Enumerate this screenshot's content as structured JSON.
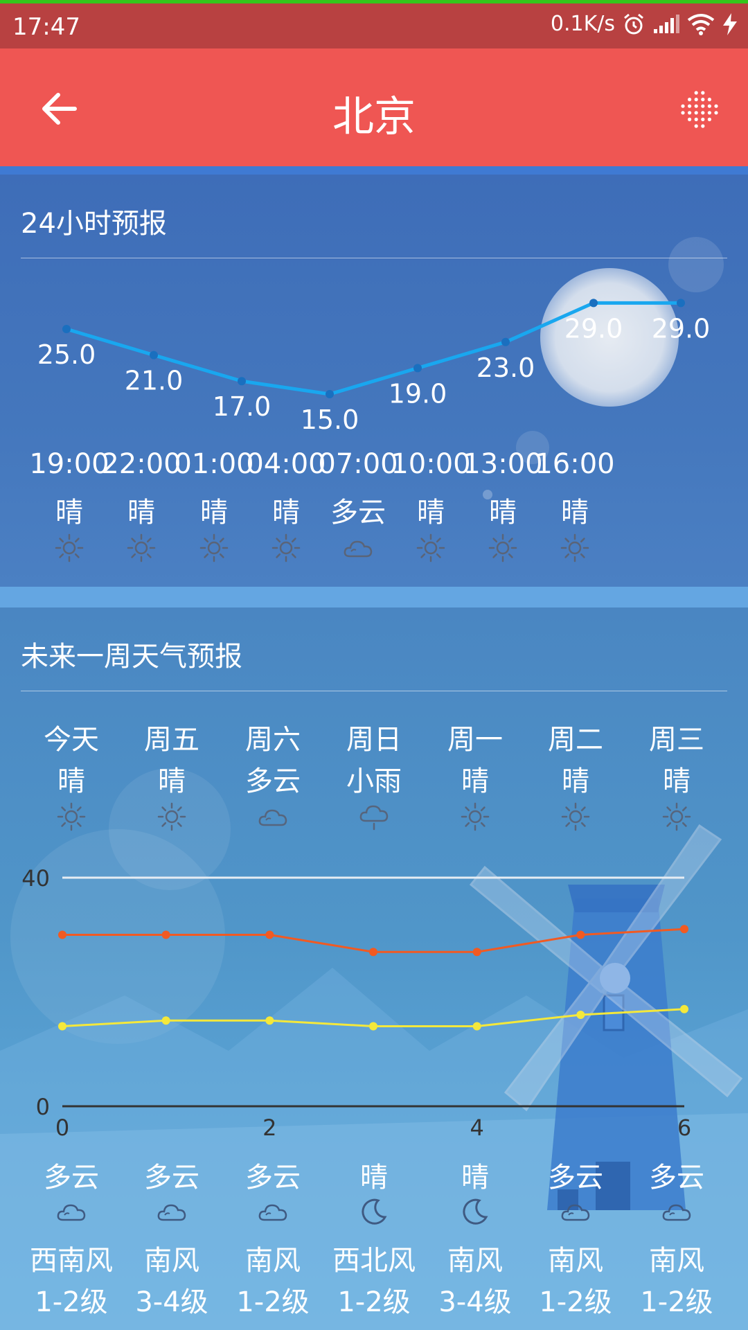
{
  "status_bar": {
    "time": "17:47",
    "net_speed": "0.1K/s",
    "icons": [
      "alarm-icon",
      "signal-icon",
      "wifi-icon",
      "charging-icon"
    ]
  },
  "app_bar": {
    "title": "北京",
    "back_icon": "arrow-left-icon",
    "menu_icon": "dots-grid-icon"
  },
  "hourly": {
    "title": "24小时预报",
    "items": [
      {
        "time": "19:00",
        "temp": "25.0",
        "desc": "晴",
        "icon": "sun-icon"
      },
      {
        "time": "22:00",
        "temp": "21.0",
        "desc": "晴",
        "icon": "sun-icon"
      },
      {
        "time": "01:00",
        "temp": "17.0",
        "desc": "晴",
        "icon": "sun-icon"
      },
      {
        "time": "04:00",
        "temp": "15.0",
        "desc": "晴",
        "icon": "sun-icon"
      },
      {
        "time": "07:00",
        "temp": "19.0",
        "desc": "多云",
        "icon": "cloud-icon"
      },
      {
        "time": "10:00",
        "temp": "23.0",
        "desc": "晴",
        "icon": "sun-icon"
      },
      {
        "time": "13:00",
        "temp": "29.0",
        "desc": "晴",
        "icon": "sun-icon"
      },
      {
        "time": "16:00",
        "temp": "29.0",
        "desc": "晴",
        "icon": "sun-icon"
      }
    ],
    "line_color": "#19a7ef"
  },
  "weekly": {
    "title": "未来一周天气预报",
    "days": [
      {
        "name": "今天",
        "day_desc": "晴",
        "day_icon": "sun-icon",
        "night_desc": "多云",
        "night_icon": "cloud-icon",
        "wind_dir": "西南风",
        "wind_level": "1-2级"
      },
      {
        "name": "周五",
        "day_desc": "晴",
        "day_icon": "sun-icon",
        "night_desc": "多云",
        "night_icon": "cloud-icon",
        "wind_dir": "南风",
        "wind_level": "3-4级"
      },
      {
        "name": "周六",
        "day_desc": "多云",
        "day_icon": "cloud-icon",
        "night_desc": "多云",
        "night_icon": "cloud-icon",
        "wind_dir": "南风",
        "wind_level": "1-2级"
      },
      {
        "name": "周日",
        "day_desc": "小雨",
        "day_icon": "rain-icon",
        "night_desc": "晴",
        "night_icon": "moon-icon",
        "wind_dir": "西北风",
        "wind_level": "1-2级"
      },
      {
        "name": "周一",
        "day_desc": "晴",
        "day_icon": "sun-icon",
        "night_desc": "晴",
        "night_icon": "moon-icon",
        "wind_dir": "南风",
        "wind_level": "3-4级"
      },
      {
        "name": "周二",
        "day_desc": "晴",
        "day_icon": "sun-icon",
        "night_desc": "多云",
        "night_icon": "cloud-icon",
        "wind_dir": "南风",
        "wind_level": "1-2级"
      },
      {
        "name": "周三",
        "day_desc": "晴",
        "day_icon": "sun-icon",
        "night_desc": "多云",
        "night_icon": "cloud-icon",
        "wind_dir": "南风",
        "wind_level": "1-2级"
      }
    ]
  },
  "chart_data": {
    "type": "line",
    "x": [
      0,
      1,
      2,
      3,
      4,
      5,
      6
    ],
    "x_ticks": [
      "0",
      "2",
      "4",
      "6"
    ],
    "y_ticks": [
      "0",
      "40"
    ],
    "ylim": [
      0,
      40
    ],
    "xlim": [
      0,
      6
    ],
    "series": [
      {
        "values": [
          30,
          30,
          30,
          27,
          27,
          30,
          31
        ],
        "color": "#f15a22"
      },
      {
        "values": [
          14,
          15,
          15,
          14,
          14,
          16,
          17
        ],
        "color": "#f4e83b"
      }
    ],
    "grid_line_color": "#e6ecf3",
    "axis_color": "#333333"
  }
}
